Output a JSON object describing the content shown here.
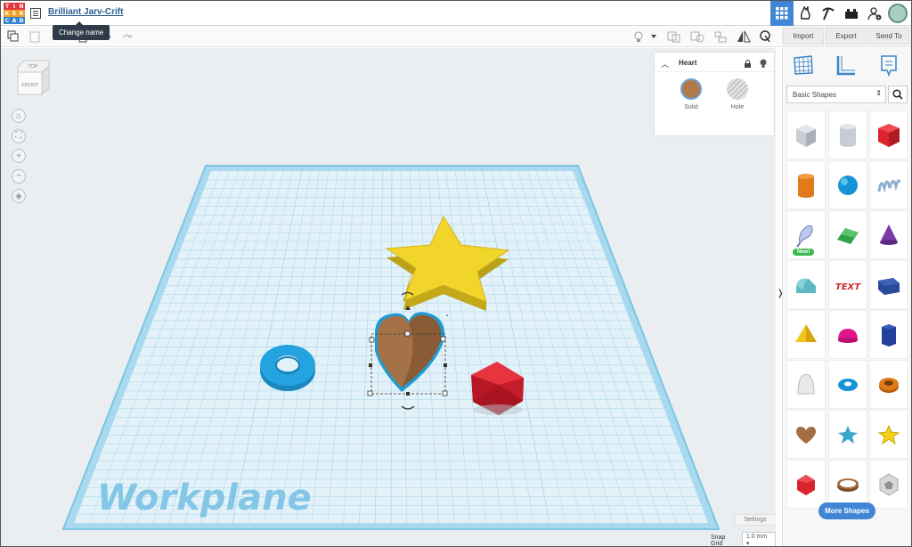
{
  "app": {
    "logo_letters": [
      "T",
      "I",
      "N",
      "K",
      "E",
      "R",
      "C",
      "A",
      "D"
    ],
    "logo_colors": [
      "#e2373f",
      "#e2373f",
      "#e2373f",
      "#f2a02b",
      "#f2a02b",
      "#f2a02b",
      "#3584cf",
      "#3584cf",
      "#3584cf"
    ],
    "design_title": "Brilliant Jarv-Crift",
    "tooltip": "Change name"
  },
  "header_icons": [
    "3d-design-grid-icon",
    "codeblocks-icon",
    "build-pickaxe-icon",
    "bricks-icon",
    "add-user-icon",
    "profile-avatar"
  ],
  "actions": {
    "import": "Import",
    "export": "Export",
    "send_to": "Send To"
  },
  "viewcube": {
    "top": "TOP",
    "front": "FRONT"
  },
  "inspector": {
    "title": "Heart",
    "solid_label": "Solid",
    "hole_label": "Hole",
    "solid_color": "#b07a4a"
  },
  "workplane": {
    "label": "Workplane"
  },
  "canvas_footer": {
    "settings": "Settings",
    "snap_label": "Snap Grid",
    "snap_value": "1.0 mm"
  },
  "sidebar": {
    "category": "Basic Shapes",
    "new_badge": "New!",
    "more_button": "More Shapes",
    "shapes": [
      {
        "name": "box-hole",
        "color": "#c8ccd4"
      },
      {
        "name": "cylinder-hole",
        "color": "#c8ccd4"
      },
      {
        "name": "box",
        "color": "#d9232e"
      },
      {
        "name": "cylinder",
        "color": "#e07a1a"
      },
      {
        "name": "sphere",
        "color": "#1593d4"
      },
      {
        "name": "scribble",
        "color": "#a8c0d8"
      },
      {
        "name": "shape-generator",
        "color": "#bfc8e8"
      },
      {
        "name": "roof",
        "color": "#2ea34a"
      },
      {
        "name": "cone",
        "color": "#7c3aa8"
      },
      {
        "name": "round-roof",
        "color": "#5fb8c2"
      },
      {
        "name": "text",
        "color": "#d22a2a"
      },
      {
        "name": "half-cylinder",
        "color": "#2a4a9a"
      },
      {
        "name": "pyramid",
        "color": "#f4c41a"
      },
      {
        "name": "half-sphere",
        "color": "#e0168c"
      },
      {
        "name": "polygon",
        "color": "#23409a"
      },
      {
        "name": "paraboloid",
        "color": "#e8e8e8"
      },
      {
        "name": "torus",
        "color": "#1593d4"
      },
      {
        "name": "tube",
        "color": "#e07a1a"
      },
      {
        "name": "heart",
        "color": "#a36f42"
      },
      {
        "name": "star",
        "color": "#3aa7c8"
      },
      {
        "name": "star-yellow",
        "color": "#f4d21a"
      },
      {
        "name": "icosahedron",
        "color": "#d9232e"
      },
      {
        "name": "ring",
        "color": "#a36f42"
      },
      {
        "name": "soccer-ball",
        "color": "#d8d8d8"
      }
    ]
  }
}
